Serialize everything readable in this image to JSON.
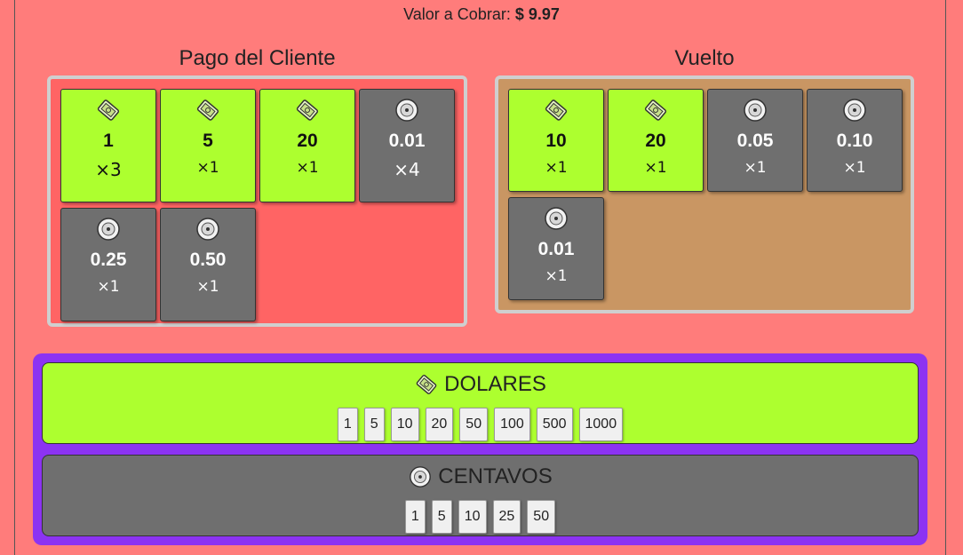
{
  "header": {
    "label": "Valor a Cobrar:",
    "value": "$ 9.97"
  },
  "pago": {
    "title": "Pago del Cliente",
    "items": [
      {
        "kind": "bill",
        "value": "1",
        "qty": "×3"
      },
      {
        "kind": "bill",
        "value": "5",
        "qty": "×1"
      },
      {
        "kind": "bill",
        "value": "20",
        "qty": "×1"
      },
      {
        "kind": "coin",
        "value": "0.01",
        "qty": "×4"
      },
      {
        "kind": "coin",
        "value": "0.25",
        "qty": "×1"
      },
      {
        "kind": "coin",
        "value": "0.50",
        "qty": "×1"
      }
    ]
  },
  "vuelto": {
    "title": "Vuelto",
    "items": [
      {
        "kind": "bill",
        "value": "10",
        "qty": "×1"
      },
      {
        "kind": "bill",
        "value": "20",
        "qty": "×1"
      },
      {
        "kind": "coin",
        "value": "0.05",
        "qty": "×1"
      },
      {
        "kind": "coin",
        "value": "0.10",
        "qty": "×1"
      },
      {
        "kind": "coin",
        "value": "0.01",
        "qty": "×1"
      }
    ]
  },
  "dolares": {
    "title": "DOLARES",
    "icon": "banknote-icon",
    "buttons": [
      "1",
      "5",
      "10",
      "20",
      "50",
      "100",
      "500",
      "1000"
    ]
  },
  "centavos": {
    "title": "CENTAVOS",
    "icon": "coin-icon",
    "buttons": [
      "1",
      "5",
      "10",
      "25",
      "50"
    ]
  },
  "colors": {
    "background": "#ff7c7b",
    "bill": "#adff2f",
    "coin": "#6f6f6f",
    "pago_panel": "#ff6464",
    "vuelto_panel": "#c99663",
    "keypad": "#8c33f2"
  }
}
